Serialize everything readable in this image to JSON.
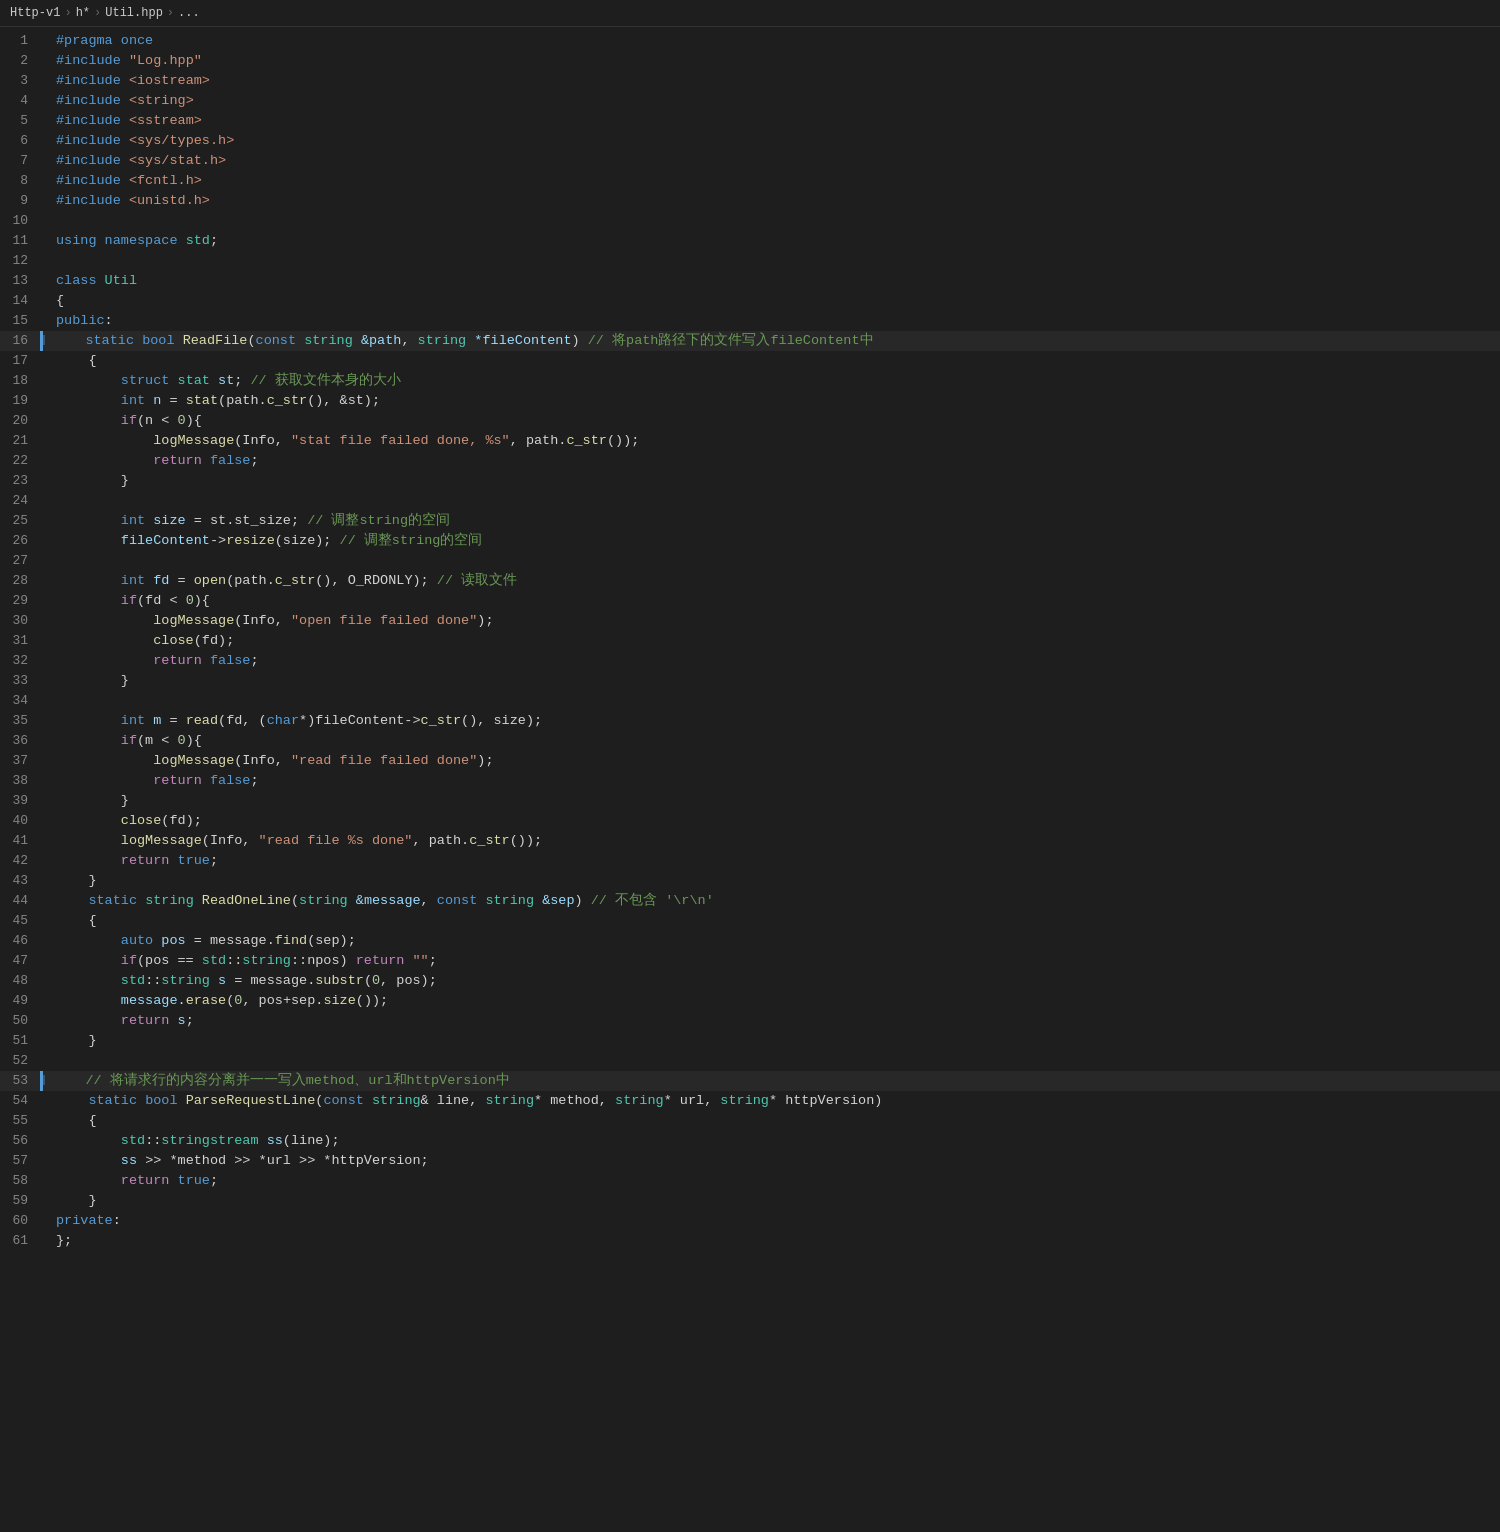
{
  "breadcrumb": {
    "items": [
      "Http-v1",
      "h*",
      "Util.hpp",
      "..."
    ]
  },
  "title": "Util.hpp",
  "lines": [
    {
      "n": 1,
      "tokens": [
        {
          "t": "#pragma once",
          "c": "macro"
        }
      ]
    },
    {
      "n": 2,
      "tokens": [
        {
          "t": "#include ",
          "c": "macro"
        },
        {
          "t": "\"Log.hpp\"",
          "c": "incl"
        }
      ]
    },
    {
      "n": 3,
      "tokens": [
        {
          "t": "#include ",
          "c": "macro"
        },
        {
          "t": "<iostream>",
          "c": "incl"
        }
      ]
    },
    {
      "n": 4,
      "tokens": [
        {
          "t": "#include ",
          "c": "macro"
        },
        {
          "t": "<string>",
          "c": "incl"
        }
      ]
    },
    {
      "n": 5,
      "tokens": [
        {
          "t": "#include ",
          "c": "macro"
        },
        {
          "t": "<sstream>",
          "c": "incl"
        }
      ]
    },
    {
      "n": 6,
      "tokens": [
        {
          "t": "#include ",
          "c": "macro"
        },
        {
          "t": "<sys/types.h>",
          "c": "incl"
        }
      ]
    },
    {
      "n": 7,
      "tokens": [
        {
          "t": "#include ",
          "c": "macro"
        },
        {
          "t": "<sys/stat.h>",
          "c": "incl"
        }
      ]
    },
    {
      "n": 8,
      "tokens": [
        {
          "t": "#include ",
          "c": "macro"
        },
        {
          "t": "<fcntl.h>",
          "c": "incl"
        }
      ]
    },
    {
      "n": 9,
      "tokens": [
        {
          "t": "#include ",
          "c": "macro"
        },
        {
          "t": "<unistd.h>",
          "c": "incl"
        }
      ]
    },
    {
      "n": 10,
      "tokens": []
    },
    {
      "n": 11,
      "tokens": [
        {
          "t": "using ",
          "c": "kw"
        },
        {
          "t": "namespace ",
          "c": "kw"
        },
        {
          "t": "std",
          "c": "ns"
        },
        {
          "t": ";",
          "c": "op"
        }
      ]
    },
    {
      "n": 12,
      "tokens": []
    },
    {
      "n": 13,
      "tokens": [
        {
          "t": "class ",
          "c": "kw"
        },
        {
          "t": "Util",
          "c": "class-name"
        }
      ]
    },
    {
      "n": 14,
      "tokens": [
        {
          "t": "{",
          "c": "op"
        }
      ]
    },
    {
      "n": 15,
      "tokens": [
        {
          "t": "public",
          "c": "kw"
        },
        {
          "t": ":",
          "c": "op"
        }
      ]
    },
    {
      "n": 16,
      "tokens": [
        {
          "t": "    ",
          "c": "op"
        },
        {
          "t": "static ",
          "c": "kw"
        },
        {
          "t": "bool ",
          "c": "kw"
        },
        {
          "t": "ReadFile",
          "c": "fn"
        },
        {
          "t": "(",
          "c": "op"
        },
        {
          "t": "const ",
          "c": "kw"
        },
        {
          "t": "string ",
          "c": "type"
        },
        {
          "t": "&path",
          "c": "param"
        },
        {
          "t": ", ",
          "c": "op"
        },
        {
          "t": "string ",
          "c": "type"
        },
        {
          "t": "*fileContent",
          "c": "param"
        },
        {
          "t": ") ",
          "c": "op"
        },
        {
          "t": "// 将path路径下的文件写入fileContent中",
          "c": "comment"
        }
      ],
      "indicator": true
    },
    {
      "n": 17,
      "tokens": [
        {
          "t": "    {",
          "c": "op"
        }
      ]
    },
    {
      "n": 18,
      "tokens": [
        {
          "t": "        ",
          "c": "op"
        },
        {
          "t": "struct ",
          "c": "kw"
        },
        {
          "t": "stat ",
          "c": "type"
        },
        {
          "t": "st",
          "c": "var"
        },
        {
          "t": "; ",
          "c": "op"
        },
        {
          "t": "// 获取文件本身的大小",
          "c": "comment"
        }
      ]
    },
    {
      "n": 19,
      "tokens": [
        {
          "t": "        ",
          "c": "op"
        },
        {
          "t": "int ",
          "c": "kw"
        },
        {
          "t": "n ",
          "c": "var"
        },
        {
          "t": "= ",
          "c": "op"
        },
        {
          "t": "stat",
          "c": "fn"
        },
        {
          "t": "(path.",
          "c": "op"
        },
        {
          "t": "c_str",
          "c": "fn"
        },
        {
          "t": "(), &st);",
          "c": "op"
        }
      ]
    },
    {
      "n": 20,
      "tokens": [
        {
          "t": "        ",
          "c": "op"
        },
        {
          "t": "if",
          "c": "kw2"
        },
        {
          "t": "(n < ",
          "c": "op"
        },
        {
          "t": "0",
          "c": "num"
        },
        {
          "t": "){",
          "c": "op"
        }
      ]
    },
    {
      "n": 21,
      "tokens": [
        {
          "t": "            ",
          "c": "op"
        },
        {
          "t": "logMessage",
          "c": "fn"
        },
        {
          "t": "(Info, ",
          "c": "op"
        },
        {
          "t": "\"stat file failed done, %s\"",
          "c": "str"
        },
        {
          "t": ", path.",
          "c": "op"
        },
        {
          "t": "c_str",
          "c": "fn"
        },
        {
          "t": "());",
          "c": "op"
        }
      ]
    },
    {
      "n": 22,
      "tokens": [
        {
          "t": "            ",
          "c": "op"
        },
        {
          "t": "return ",
          "c": "kw2"
        },
        {
          "t": "false",
          "c": "kw"
        },
        {
          "t": ";",
          "c": "op"
        }
      ]
    },
    {
      "n": 23,
      "tokens": [
        {
          "t": "        }",
          "c": "op"
        }
      ]
    },
    {
      "n": 24,
      "tokens": []
    },
    {
      "n": 25,
      "tokens": [
        {
          "t": "        ",
          "c": "op"
        },
        {
          "t": "int ",
          "c": "kw"
        },
        {
          "t": "size ",
          "c": "var"
        },
        {
          "t": "= st.st_size;",
          "c": "op"
        },
        {
          "t": " // 调整string的空间",
          "c": "comment"
        }
      ]
    },
    {
      "n": 26,
      "tokens": [
        {
          "t": "        ",
          "c": "op"
        },
        {
          "t": "fileContent",
          "c": "var"
        },
        {
          "t": "->",
          "c": "arrow"
        },
        {
          "t": "resize",
          "c": "fn"
        },
        {
          "t": "(size); ",
          "c": "op"
        },
        {
          "t": "// 调整string的空间",
          "c": "comment"
        }
      ]
    },
    {
      "n": 27,
      "tokens": []
    },
    {
      "n": 28,
      "tokens": [
        {
          "t": "        ",
          "c": "op"
        },
        {
          "t": "int ",
          "c": "kw"
        },
        {
          "t": "fd ",
          "c": "var"
        },
        {
          "t": "= ",
          "c": "op"
        },
        {
          "t": "open",
          "c": "fn"
        },
        {
          "t": "(path.",
          "c": "op"
        },
        {
          "t": "c_str",
          "c": "fn"
        },
        {
          "t": "(), O_RDONLY); ",
          "c": "op"
        },
        {
          "t": "// 读取文件",
          "c": "comment"
        }
      ]
    },
    {
      "n": 29,
      "tokens": [
        {
          "t": "        ",
          "c": "op"
        },
        {
          "t": "if",
          "c": "kw2"
        },
        {
          "t": "(fd < ",
          "c": "op"
        },
        {
          "t": "0",
          "c": "num"
        },
        {
          "t": "){",
          "c": "op"
        }
      ]
    },
    {
      "n": 30,
      "tokens": [
        {
          "t": "            ",
          "c": "op"
        },
        {
          "t": "logMessage",
          "c": "fn"
        },
        {
          "t": "(Info, ",
          "c": "op"
        },
        {
          "t": "\"open file failed done\"",
          "c": "str"
        },
        {
          "t": ");",
          "c": "op"
        }
      ]
    },
    {
      "n": 31,
      "tokens": [
        {
          "t": "            ",
          "c": "op"
        },
        {
          "t": "close",
          "c": "fn"
        },
        {
          "t": "(fd);",
          "c": "op"
        }
      ]
    },
    {
      "n": 32,
      "tokens": [
        {
          "t": "            ",
          "c": "op"
        },
        {
          "t": "return ",
          "c": "kw2"
        },
        {
          "t": "false",
          "c": "kw"
        },
        {
          "t": ";",
          "c": "op"
        }
      ]
    },
    {
      "n": 33,
      "tokens": [
        {
          "t": "        }",
          "c": "op"
        }
      ]
    },
    {
      "n": 34,
      "tokens": []
    },
    {
      "n": 35,
      "tokens": [
        {
          "t": "        ",
          "c": "op"
        },
        {
          "t": "int ",
          "c": "kw"
        },
        {
          "t": "m ",
          "c": "var"
        },
        {
          "t": "= ",
          "c": "op"
        },
        {
          "t": "read",
          "c": "fn"
        },
        {
          "t": "(fd, (",
          "c": "op"
        },
        {
          "t": "char",
          "c": "kw"
        },
        {
          "t": "*)fileContent->",
          "c": "op"
        },
        {
          "t": "c_str",
          "c": "fn"
        },
        {
          "t": "(), size);",
          "c": "op"
        }
      ]
    },
    {
      "n": 36,
      "tokens": [
        {
          "t": "        ",
          "c": "op"
        },
        {
          "t": "if",
          "c": "kw2"
        },
        {
          "t": "(m < ",
          "c": "op"
        },
        {
          "t": "0",
          "c": "num"
        },
        {
          "t": "){",
          "c": "op"
        }
      ]
    },
    {
      "n": 37,
      "tokens": [
        {
          "t": "            ",
          "c": "op"
        },
        {
          "t": "logMessage",
          "c": "fn"
        },
        {
          "t": "(Info, ",
          "c": "op"
        },
        {
          "t": "\"read file failed done\"",
          "c": "str"
        },
        {
          "t": ");",
          "c": "op"
        }
      ]
    },
    {
      "n": 38,
      "tokens": [
        {
          "t": "            ",
          "c": "op"
        },
        {
          "t": "return ",
          "c": "kw2"
        },
        {
          "t": "false",
          "c": "kw"
        },
        {
          "t": ";",
          "c": "op"
        }
      ]
    },
    {
      "n": 39,
      "tokens": [
        {
          "t": "        }",
          "c": "op"
        }
      ]
    },
    {
      "n": 40,
      "tokens": [
        {
          "t": "        ",
          "c": "op"
        },
        {
          "t": "close",
          "c": "fn"
        },
        {
          "t": "(fd);",
          "c": "op"
        }
      ]
    },
    {
      "n": 41,
      "tokens": [
        {
          "t": "        ",
          "c": "op"
        },
        {
          "t": "logMessage",
          "c": "fn"
        },
        {
          "t": "(Info, ",
          "c": "op"
        },
        {
          "t": "\"read file %s done\"",
          "c": "str"
        },
        {
          "t": ", path.",
          "c": "op"
        },
        {
          "t": "c_str",
          "c": "fn"
        },
        {
          "t": "());",
          "c": "op"
        }
      ]
    },
    {
      "n": 42,
      "tokens": [
        {
          "t": "        ",
          "c": "op"
        },
        {
          "t": "return ",
          "c": "kw2"
        },
        {
          "t": "true",
          "c": "kw"
        },
        {
          "t": ";",
          "c": "op"
        }
      ]
    },
    {
      "n": 43,
      "tokens": [
        {
          "t": "    }",
          "c": "op"
        }
      ]
    },
    {
      "n": 44,
      "tokens": [
        {
          "t": "    ",
          "c": "op"
        },
        {
          "t": "static ",
          "c": "kw"
        },
        {
          "t": "string ",
          "c": "type"
        },
        {
          "t": "ReadOneLine",
          "c": "fn"
        },
        {
          "t": "(",
          "c": "op"
        },
        {
          "t": "string ",
          "c": "type"
        },
        {
          "t": "&message",
          "c": "param"
        },
        {
          "t": ", ",
          "c": "op"
        },
        {
          "t": "const ",
          "c": "kw"
        },
        {
          "t": "string ",
          "c": "type"
        },
        {
          "t": "&sep",
          "c": "param"
        },
        {
          "t": ") ",
          "c": "op"
        },
        {
          "t": "// 不包含 '\\r\\n'",
          "c": "comment"
        }
      ]
    },
    {
      "n": 45,
      "tokens": [
        {
          "t": "    {",
          "c": "op"
        }
      ]
    },
    {
      "n": 46,
      "tokens": [
        {
          "t": "        ",
          "c": "op"
        },
        {
          "t": "auto ",
          "c": "kw"
        },
        {
          "t": "pos ",
          "c": "var"
        },
        {
          "t": "= message.",
          "c": "op"
        },
        {
          "t": "find",
          "c": "fn"
        },
        {
          "t": "(sep);",
          "c": "op"
        }
      ]
    },
    {
      "n": 47,
      "tokens": [
        {
          "t": "        ",
          "c": "op"
        },
        {
          "t": "if",
          "c": "kw2"
        },
        {
          "t": "(pos == ",
          "c": "op"
        },
        {
          "t": "std",
          "c": "ns"
        },
        {
          "t": "::",
          "c": "op"
        },
        {
          "t": "string",
          "c": "type"
        },
        {
          "t": "::npos) ",
          "c": "op"
        },
        {
          "t": "return ",
          "c": "kw2"
        },
        {
          "t": "\"\"",
          "c": "str"
        },
        {
          "t": ";",
          "c": "op"
        }
      ]
    },
    {
      "n": 48,
      "tokens": [
        {
          "t": "        ",
          "c": "op"
        },
        {
          "t": "std",
          "c": "ns"
        },
        {
          "t": "::",
          "c": "op"
        },
        {
          "t": "string ",
          "c": "type"
        },
        {
          "t": "s ",
          "c": "var"
        },
        {
          "t": "= message.",
          "c": "op"
        },
        {
          "t": "substr",
          "c": "fn"
        },
        {
          "t": "(",
          "c": "op"
        },
        {
          "t": "0",
          "c": "num"
        },
        {
          "t": ", pos);",
          "c": "op"
        }
      ]
    },
    {
      "n": 49,
      "tokens": [
        {
          "t": "        ",
          "c": "op"
        },
        {
          "t": "message",
          "c": "var"
        },
        {
          "t": ".",
          "c": "op"
        },
        {
          "t": "erase",
          "c": "fn"
        },
        {
          "t": "(",
          "c": "op"
        },
        {
          "t": "0",
          "c": "num"
        },
        {
          "t": ", pos+sep.",
          "c": "op"
        },
        {
          "t": "size",
          "c": "fn"
        },
        {
          "t": "());",
          "c": "op"
        }
      ]
    },
    {
      "n": 50,
      "tokens": [
        {
          "t": "        ",
          "c": "op"
        },
        {
          "t": "return ",
          "c": "kw2"
        },
        {
          "t": "s",
          "c": "var"
        },
        {
          "t": ";",
          "c": "op"
        }
      ]
    },
    {
      "n": 51,
      "tokens": [
        {
          "t": "    }",
          "c": "op"
        }
      ]
    },
    {
      "n": 52,
      "tokens": []
    },
    {
      "n": 53,
      "tokens": [
        {
          "t": "    ",
          "c": "op"
        },
        {
          "t": "// 将请求行的内容分离并一一写入method、url和httpVersion中",
          "c": "comment"
        }
      ],
      "indicator": true
    },
    {
      "n": 54,
      "tokens": [
        {
          "t": "    ",
          "c": "op"
        },
        {
          "t": "static ",
          "c": "kw"
        },
        {
          "t": "bool ",
          "c": "kw"
        },
        {
          "t": "ParseRequestLine",
          "c": "fn"
        },
        {
          "t": "(",
          "c": "op"
        },
        {
          "t": "const ",
          "c": "kw"
        },
        {
          "t": "string",
          "c": "type"
        },
        {
          "t": "& line, ",
          "c": "op"
        },
        {
          "t": "string",
          "c": "type"
        },
        {
          "t": "* method, ",
          "c": "op"
        },
        {
          "t": "string",
          "c": "type"
        },
        {
          "t": "* url, ",
          "c": "op"
        },
        {
          "t": "string",
          "c": "type"
        },
        {
          "t": "* httpVersion)",
          "c": "op"
        }
      ]
    },
    {
      "n": 55,
      "tokens": [
        {
          "t": "    {",
          "c": "op"
        }
      ]
    },
    {
      "n": 56,
      "tokens": [
        {
          "t": "        ",
          "c": "op"
        },
        {
          "t": "std",
          "c": "ns"
        },
        {
          "t": "::",
          "c": "op"
        },
        {
          "t": "stringstream ",
          "c": "type"
        },
        {
          "t": "ss",
          "c": "var"
        },
        {
          "t": "(line);",
          "c": "op"
        }
      ]
    },
    {
      "n": 57,
      "tokens": [
        {
          "t": "        ",
          "c": "op"
        },
        {
          "t": "ss ",
          "c": "var"
        },
        {
          "t": ">> *method >> *url >> *httpVersion;",
          "c": "op"
        }
      ]
    },
    {
      "n": 58,
      "tokens": [
        {
          "t": "        ",
          "c": "op"
        },
        {
          "t": "return ",
          "c": "kw2"
        },
        {
          "t": "true",
          "c": "kw"
        },
        {
          "t": ";",
          "c": "op"
        }
      ]
    },
    {
      "n": 59,
      "tokens": [
        {
          "t": "    }",
          "c": "op"
        }
      ]
    },
    {
      "n": 60,
      "tokens": [
        {
          "t": "private",
          "c": "kw"
        },
        {
          "t": ":",
          "c": "op"
        }
      ]
    },
    {
      "n": 61,
      "tokens": [
        {
          "t": "};",
          "c": "op"
        }
      ]
    }
  ]
}
